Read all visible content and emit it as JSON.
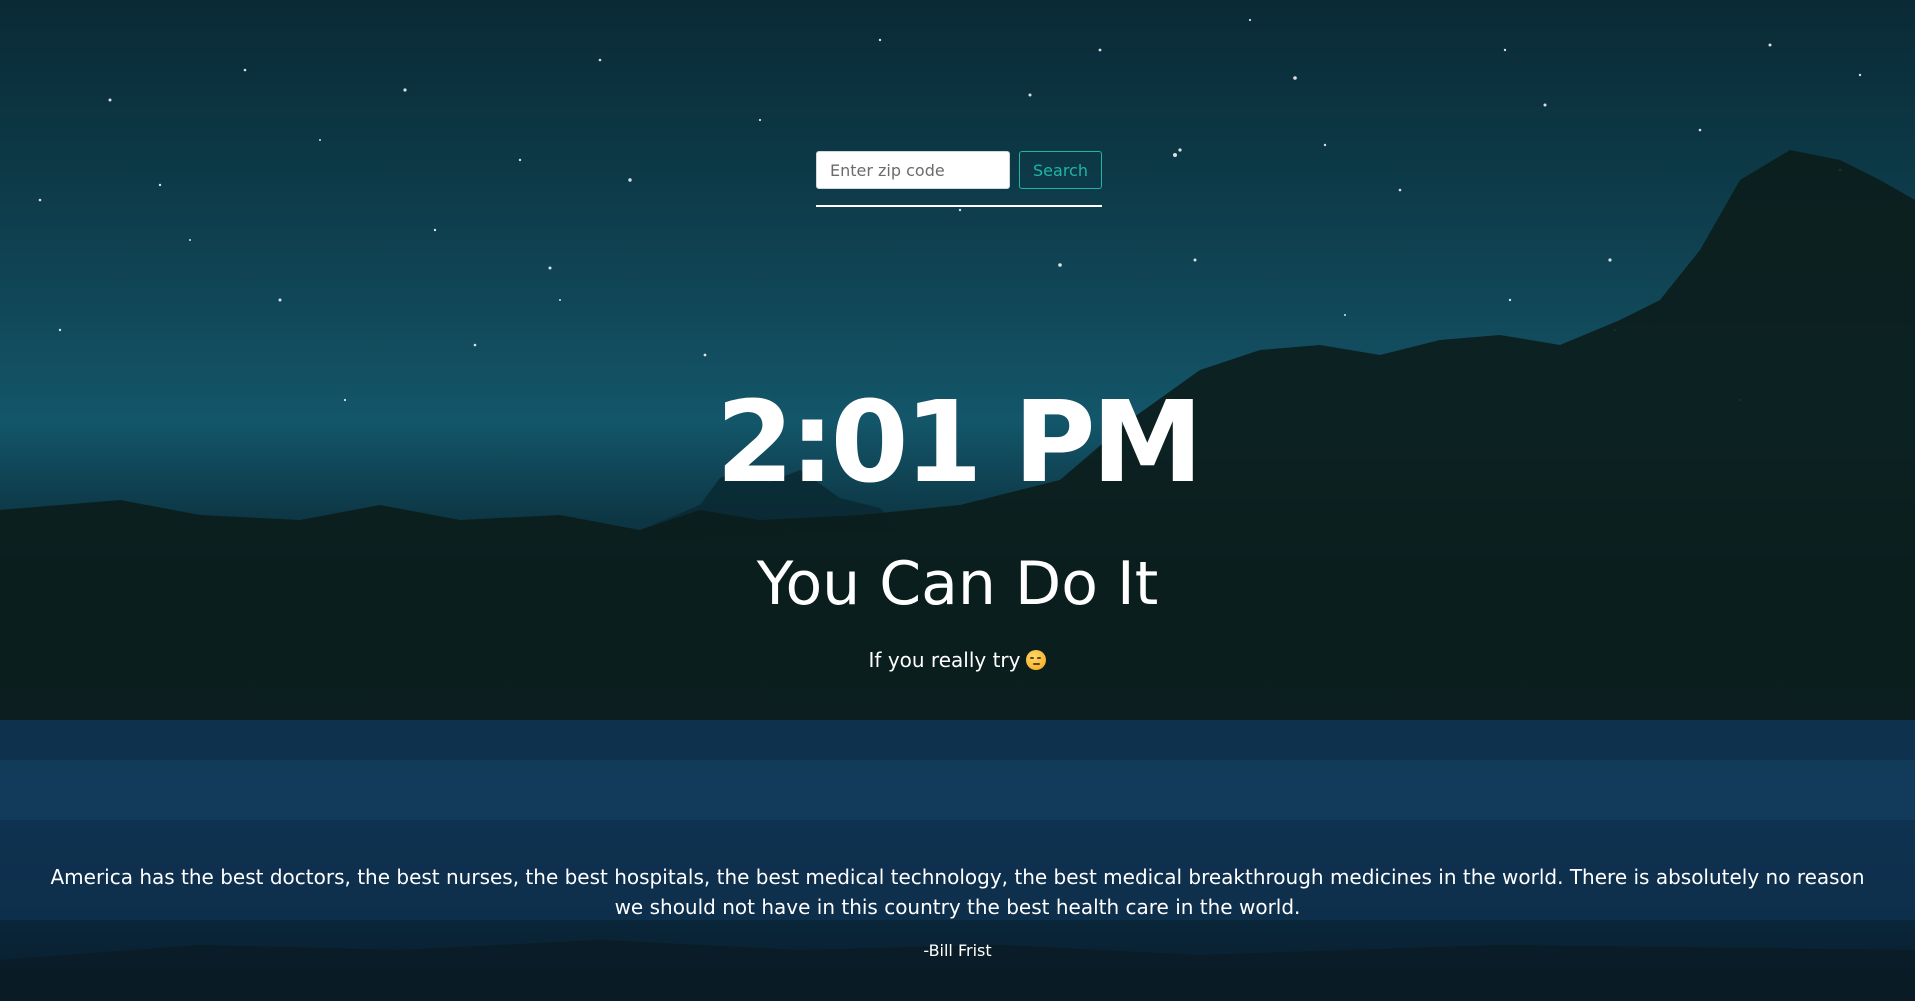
{
  "search": {
    "placeholder": "Enter zip code",
    "button_label": "Search"
  },
  "clock": {
    "time": "2:01 PM"
  },
  "headline": {
    "text": "You Can Do It"
  },
  "subline": {
    "text": "If you really try",
    "emoji_icon": "smirking-face-icon"
  },
  "quote": {
    "text": "America has the best doctors, the best nurses, the best hospitals, the best medical technology, the best medical breakthrough medicines in the world. There is absolutely no reason we should not have in this country the best health care in the world.",
    "author": "-Bill Frist"
  },
  "colors": {
    "accent": "#1fb5a8",
    "text": "#ffffff"
  }
}
